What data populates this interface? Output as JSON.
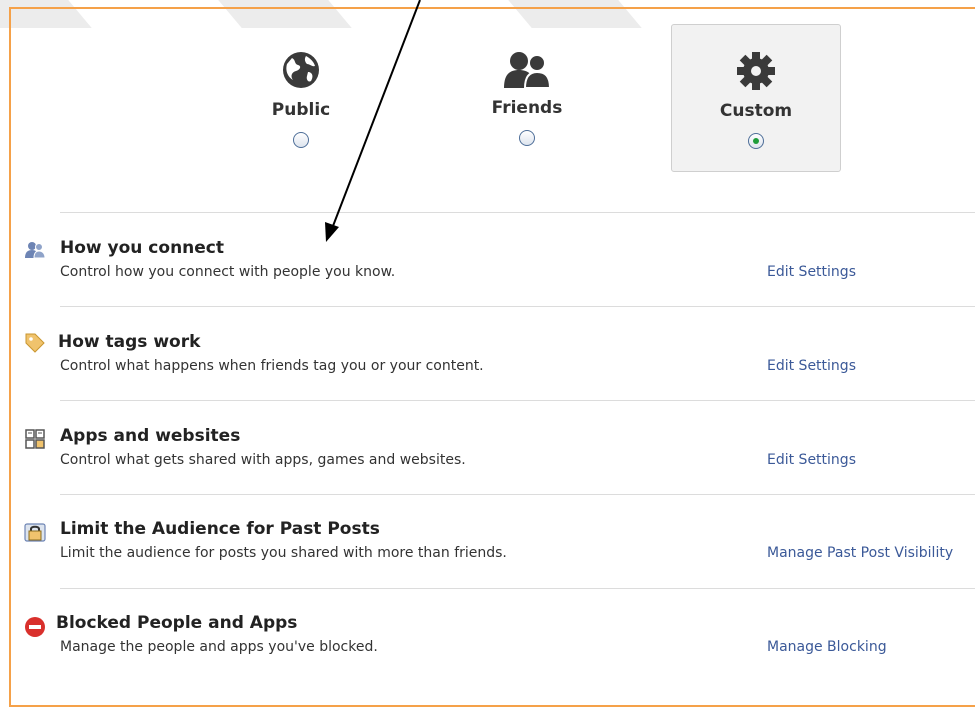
{
  "audience": {
    "options": [
      {
        "label": "Public",
        "icon": "globe-icon",
        "selected": false
      },
      {
        "label": "Friends",
        "icon": "friends-icon",
        "selected": false
      },
      {
        "label": "Custom",
        "icon": "gear-icon",
        "selected": true
      }
    ]
  },
  "settings": [
    {
      "title": "How you connect",
      "description": "Control how you connect with people you know.",
      "link": "Edit Settings",
      "icon": "people-icon"
    },
    {
      "title": "How tags work",
      "description": "Control what happens when friends tag you or your content.",
      "link": "Edit Settings",
      "icon": "tag-icon"
    },
    {
      "title": "Apps and websites",
      "description": "Control what gets shared with apps, games and websites.",
      "link": "Edit Settings",
      "icon": "apps-icon"
    },
    {
      "title": "Limit the Audience for Past Posts",
      "description": "Limit the audience for posts you shared with more than friends.",
      "link": "Manage Past Post Visibility",
      "icon": "lock-icon"
    },
    {
      "title": "Blocked People and Apps",
      "description": "Manage the people and apps you've blocked.",
      "link": "Manage Blocking",
      "icon": "blocked-icon"
    }
  ],
  "colors": {
    "frame": "#f5a149",
    "link": "#3b5998",
    "selected_radio": "#1e9d3a",
    "blocked": "#d9302c"
  }
}
